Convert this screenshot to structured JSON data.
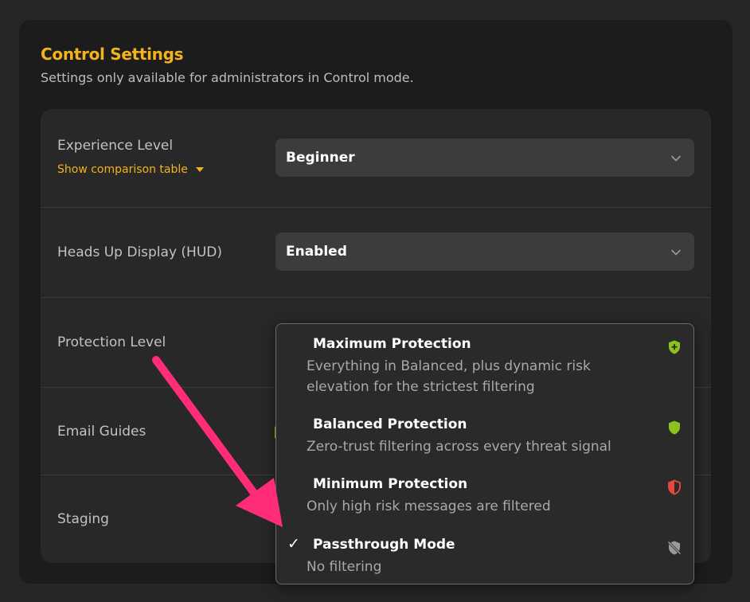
{
  "header": {
    "title": "Control Settings",
    "subtitle": "Settings only available for administrators in Control mode."
  },
  "settings": {
    "experience": {
      "label": "Experience Level",
      "link": "Show comparison table",
      "value": "Beginner"
    },
    "hud": {
      "label": "Heads Up Display (HUD)",
      "value": "Enabled"
    },
    "protection": {
      "label": "Protection Level"
    },
    "email": {
      "label": "Email Guides"
    },
    "staging": {
      "label": "Staging"
    }
  },
  "dropdown": {
    "options": [
      {
        "title": "Maximum Protection",
        "desc": "Everything in Balanced, plus dynamic risk elevation for the strictest filtering",
        "icon": "shield-plus-icon",
        "icon_color": "#8bc21c",
        "selected": false
      },
      {
        "title": "Balanced Protection",
        "desc": "Zero-trust filtering across every threat signal",
        "icon": "shield-icon",
        "icon_color": "#8bc21c",
        "selected": false
      },
      {
        "title": "Minimum Protection",
        "desc": "Only high risk messages are filtered",
        "icon": "shield-half-icon",
        "icon_color": "#e5493a",
        "selected": false
      },
      {
        "title": "Passthrough Mode",
        "desc": "No filtering",
        "icon": "shield-off-icon",
        "icon_color": "#9a9a9a",
        "selected": true,
        "check": "✓"
      }
    ]
  },
  "colors": {
    "accent": "#f2b31b",
    "annotation_arrow": "#ff2d78"
  }
}
